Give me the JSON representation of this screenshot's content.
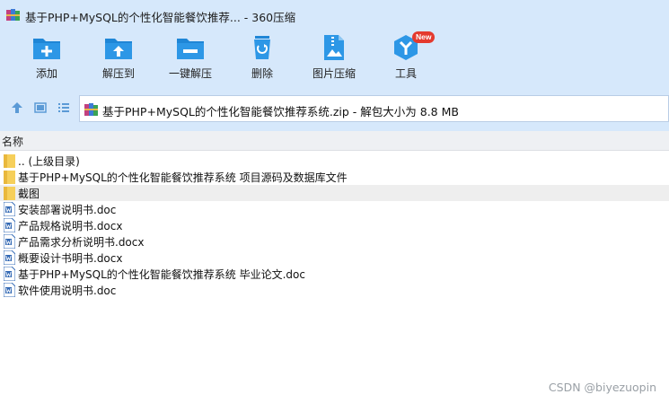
{
  "window": {
    "title": "基于PHP+MySQL的个性化智能餐饮推荐... - 360压缩",
    "app_icon": "winrar-books-icon"
  },
  "toolbar": {
    "items": [
      {
        "label": "添加",
        "icon": "add-folder-icon"
      },
      {
        "label": "解压到",
        "icon": "extract-folder-icon"
      },
      {
        "label": "一键解压",
        "icon": "one-click-extract-icon"
      },
      {
        "label": "删除",
        "icon": "recycle-bin-icon"
      },
      {
        "label": "图片压缩",
        "icon": "image-compress-icon"
      },
      {
        "label": "工具",
        "icon": "tools-icon",
        "badge": "New"
      }
    ]
  },
  "address": {
    "path": "基于PHP+MySQL的个性化智能餐饮推荐系统.zip - 解包大小为 8.8 MB"
  },
  "list": {
    "column_name": "名称",
    "items": [
      {
        "name": ".. (上级目录)",
        "type": "folder"
      },
      {
        "name": "基于PHP+MySQL的个性化智能餐饮推荐系统 项目源码及数据库文件",
        "type": "folder"
      },
      {
        "name": "截图",
        "type": "folder",
        "selected": true
      },
      {
        "name": "安装部署说明书.doc",
        "type": "word"
      },
      {
        "name": "产品规格说明书.docx",
        "type": "word"
      },
      {
        "name": "产品需求分析说明书.docx",
        "type": "word"
      },
      {
        "name": "概要设计书明书.docx",
        "type": "word"
      },
      {
        "name": "基于PHP+MySQL的个性化智能餐饮推荐系统 毕业论文.doc",
        "type": "word"
      },
      {
        "name": "软件使用说明书.doc",
        "type": "word"
      }
    ]
  },
  "watermark": "CSDN @biyezuopin",
  "colors": {
    "chrome_bg": "#d6e8fb",
    "icon_blue": "#1f86d6",
    "folder_yellow": "#f6cf5a",
    "badge_red": "#e43a2e"
  }
}
